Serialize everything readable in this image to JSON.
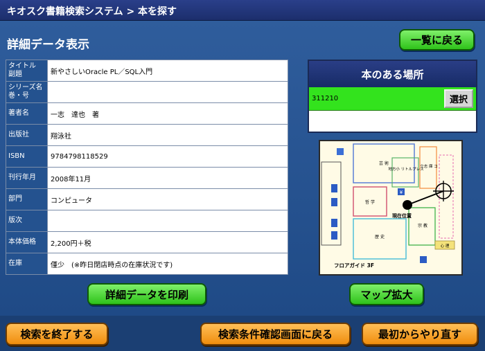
{
  "header": {
    "breadcrumb": "キオスク書籍検索システム > 本を探す"
  },
  "page": {
    "title": "詳細データ表示",
    "back_to_list": "一覧に戻る"
  },
  "details": [
    {
      "label": "タイトル\n副題",
      "value": "新やさしいOracle PL／SQL入門"
    },
    {
      "label": "シリーズ名\n巻・号",
      "value": ""
    },
    {
      "label": "著者名",
      "value": "一志　達也　著"
    },
    {
      "label": "出版社",
      "value": "翔泳社"
    },
    {
      "label": "ISBN",
      "value": "9784798118529"
    },
    {
      "label": "刊行年月",
      "value": "2008年11月"
    },
    {
      "label": "部門",
      "value": "コンピュータ"
    },
    {
      "label": "版次",
      "value": ""
    },
    {
      "label": "本体価格",
      "value": "2,200円＋税"
    },
    {
      "label": "在庫",
      "value": "僅少　(※昨日閉店時点の在庫状況です)"
    }
  ],
  "location": {
    "heading": "本のある場所",
    "code": "311210",
    "select_label": "選択"
  },
  "map": {
    "areas": {
      "geijutsu": "芸 術",
      "chihou": "地方小\nリトルプレス",
      "risshi": "立志\n庫 コ",
      "tetsugaku": "哲 学",
      "rekishi": "歴 史",
      "shuukyou": "宗 教",
      "shinri": "心 理"
    },
    "current_position": "現在位置",
    "floor_guide": "フロアガイド 3F",
    "icon_yen": "¥"
  },
  "actions": {
    "print": "詳細データを印刷",
    "map_zoom": "マップ拡大",
    "end_search": "検索を終了する",
    "back_to_conditions": "検索条件確認画面に戻る",
    "restart": "最初からやり直す"
  },
  "colors": {
    "header_bg": "#1c2e6c",
    "main_bg": "#1f4a86",
    "label_cell": "#24528f",
    "green": "#33e31d",
    "orange": "#f5a032"
  }
}
